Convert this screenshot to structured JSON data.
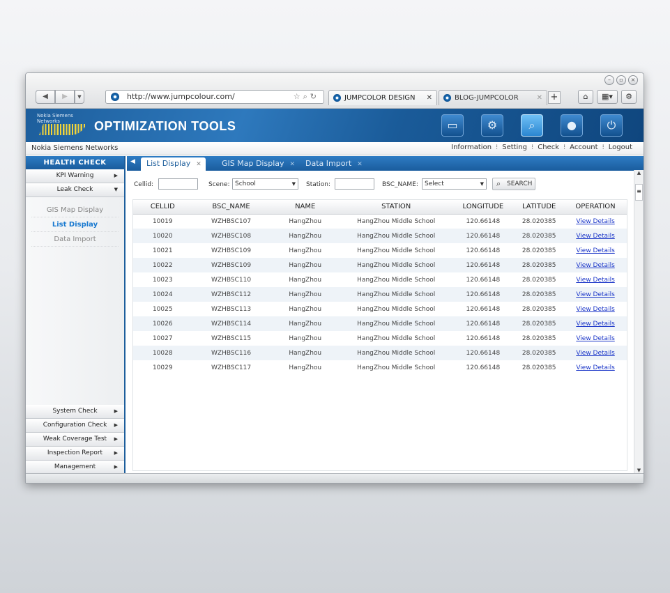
{
  "browser": {
    "url": "http://www.jumpcolour.com/",
    "tabs": [
      {
        "label": "JUMPCOLOR DESIGN"
      },
      {
        "label": "BLOG-JUMPCOLOR"
      }
    ],
    "new_tab": "+"
  },
  "header": {
    "logo_text": "Nokia Siemens Networks",
    "title": "OPTIMIZATION TOOLS",
    "icons": [
      "monitor-icon",
      "gear-icon",
      "search-icon",
      "user-icon",
      "power-icon"
    ],
    "active_icon": "search-icon"
  },
  "subnav": {
    "brand": "Nokia Siemens Networks",
    "menu": [
      "Information",
      "Setting",
      "Check",
      "Account",
      "Logout"
    ]
  },
  "sidebar": {
    "title": "HEALTH CHECK",
    "top_items": [
      {
        "label": "KPI Warning"
      },
      {
        "label": "Leak Check"
      }
    ],
    "sub_items": [
      {
        "label": "GIS Map Display"
      },
      {
        "label": "List Display",
        "active": true
      },
      {
        "label": "Data Import"
      }
    ],
    "bottom_items": [
      {
        "label": "System Check"
      },
      {
        "label": "Configuration Check"
      },
      {
        "label": "Weak Coverage Test"
      },
      {
        "label": "Inspection Report"
      },
      {
        "label": "Management"
      }
    ]
  },
  "content_tabs": [
    {
      "label": "List Display",
      "active": true
    },
    {
      "label": "GIS Map Display"
    },
    {
      "label": "Data Import"
    }
  ],
  "filters": {
    "cellid_label": "Cellid:",
    "cellid_value": "",
    "scene_label": "Scene:",
    "scene_value": "School",
    "station_label": "Station:",
    "station_value": "",
    "bsc_label": "BSC_NAME:",
    "bsc_value": "Select",
    "search_label": "SEARCH"
  },
  "table": {
    "columns": [
      "CELLID",
      "BSC_NAME",
      "NAME",
      "STATION",
      "LONGITUDE",
      "LATITUDE",
      "OPERATION"
    ],
    "rows": [
      [
        "10019",
        "WZHBSC107",
        "HangZhou",
        "HangZhou Middle School",
        "120.66148",
        "28.020385",
        "View Details"
      ],
      [
        "10020",
        "WZHBSC108",
        "HangZhou",
        "HangZhou Middle School",
        "120.66148",
        "28.020385",
        "View Details"
      ],
      [
        "10021",
        "WZHBSC109",
        "HangZhou",
        "HangZhou Middle School",
        "120.66148",
        "28.020385",
        "View Details"
      ],
      [
        "10022",
        "WZHBSC109",
        "HangZhou",
        "HangZhou Middle School",
        "120.66148",
        "28.020385",
        "View Details"
      ],
      [
        "10023",
        "WZHBSC110",
        "HangZhou",
        "HangZhou Middle School",
        "120.66148",
        "28.020385",
        "View Details"
      ],
      [
        "10024",
        "WZHBSC112",
        "HangZhou",
        "HangZhou Middle School",
        "120.66148",
        "28.020385",
        "View Details"
      ],
      [
        "10025",
        "WZHBSC113",
        "HangZhou",
        "HangZhou Middle School",
        "120.66148",
        "28.020385",
        "View Details"
      ],
      [
        "10026",
        "WZHBSC114",
        "HangZhou",
        "HangZhou Middle School",
        "120.66148",
        "28.020385",
        "View Details"
      ],
      [
        "10027",
        "WZHBSC115",
        "HangZhou",
        "HangZhou Middle School",
        "120.66148",
        "28.020385",
        "View Details"
      ],
      [
        "10028",
        "WZHBSC116",
        "HangZhou",
        "HangZhou Middle School",
        "120.66148",
        "28.020385",
        "View Details"
      ],
      [
        "10029",
        "WZHBSC117",
        "HangZhou",
        "HangZhou Middle School",
        "120.66148",
        "28.020385",
        "View Details"
      ]
    ]
  },
  "colors": {
    "brand_blue": "#1d5e9c",
    "accent_blue": "#1a7ad0",
    "link": "#1a35c8",
    "row_alt": "#eef3f8"
  }
}
